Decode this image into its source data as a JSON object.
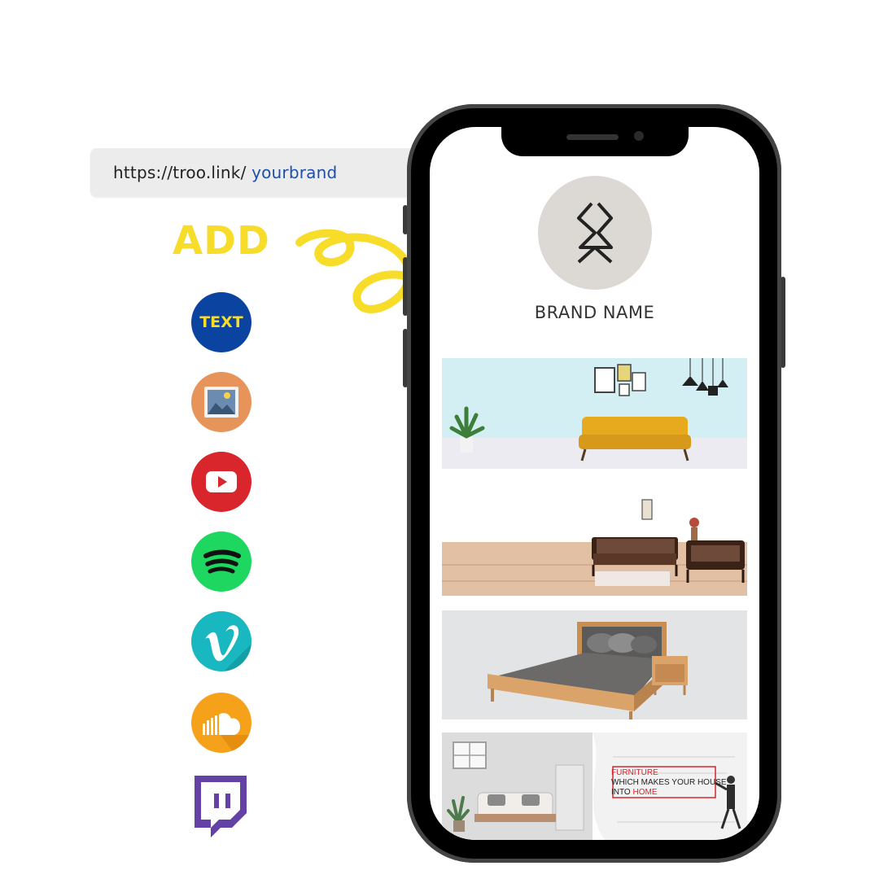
{
  "url_bar": {
    "base": "https://troo.link/",
    "brand": " yourbrand",
    "search_icon": "search-icon"
  },
  "add_label": "ADD",
  "link_types": [
    {
      "name": "text",
      "label": "TEXT",
      "color": "#0b44a0"
    },
    {
      "name": "image",
      "icon": "image-icon",
      "color": "#e6945a"
    },
    {
      "name": "youtube",
      "icon": "youtube-icon",
      "color": "#d8262c"
    },
    {
      "name": "spotify",
      "icon": "spotify-icon",
      "color": "#1ed760"
    },
    {
      "name": "vimeo",
      "icon": "vimeo-icon",
      "color": "#19b7c0"
    },
    {
      "name": "soundcloud",
      "icon": "soundcloud-icon",
      "color": "#f6a11a"
    },
    {
      "name": "twitch",
      "icon": "twitch-icon",
      "color": "#6441a5"
    }
  ],
  "phone": {
    "brand_name": "BRAND NAME",
    "cards": [
      {
        "name": "living-room-banner"
      },
      {
        "name": "sofa-set-banner"
      },
      {
        "name": "bedroom-banner"
      },
      {
        "name": "furniture-promo-banner",
        "line1": "FURNITURE",
        "line2": "WHICH MAKES YOUR HOUSE",
        "line3_a": "INTO ",
        "line3_b": "HOME"
      }
    ]
  },
  "colors": {
    "accent_yellow": "#f7dc2a",
    "brand_blue": "#1f4fa8"
  }
}
